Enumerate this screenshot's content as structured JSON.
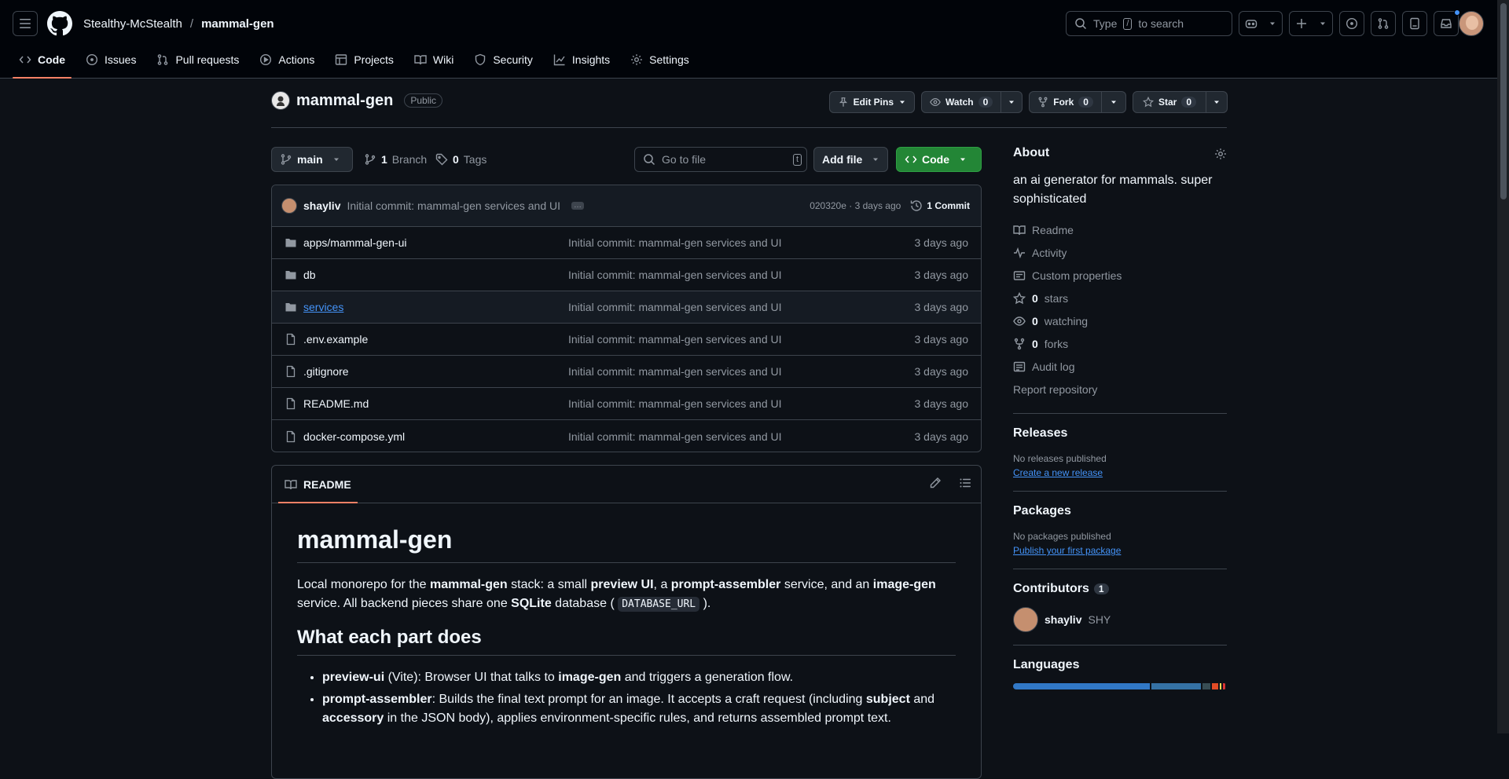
{
  "header": {
    "owner": "Stealthy-McStealth",
    "separator": "/",
    "repo": "mammal-gen",
    "search_prefix": "Type",
    "search_key": "/",
    "search_suffix": "to search"
  },
  "tabs": [
    {
      "label": "Code",
      "icon": "code-icon"
    },
    {
      "label": "Issues",
      "icon": "issue-icon"
    },
    {
      "label": "Pull requests",
      "icon": "pull-request-icon"
    },
    {
      "label": "Actions",
      "icon": "play-icon"
    },
    {
      "label": "Projects",
      "icon": "table-icon"
    },
    {
      "label": "Wiki",
      "icon": "book-icon"
    },
    {
      "label": "Security",
      "icon": "shield-icon"
    },
    {
      "label": "Insights",
      "icon": "graph-icon"
    },
    {
      "label": "Settings",
      "icon": "gear-icon"
    }
  ],
  "repo": {
    "name": "mammal-gen",
    "visibility": "Public",
    "edit_pins": "Edit Pins",
    "watch": "Watch",
    "watch_count": "0",
    "fork": "Fork",
    "fork_count": "0",
    "star": "Star",
    "star_count": "0"
  },
  "toolbar": {
    "branch": "main",
    "branches_count": "1",
    "branches_label": "Branch",
    "tags_count": "0",
    "tags_label": "Tags",
    "go_to_file": "Go to file",
    "go_to_file_key": "t",
    "add_file": "Add file",
    "code": "Code"
  },
  "commit": {
    "author": "shayliv",
    "message": "Initial commit: mammal-gen services and UI",
    "sha": "020320e",
    "dot": "·",
    "age": "3 days ago",
    "count": "1 Commit"
  },
  "files": [
    {
      "name": "apps/mammal-gen-ui",
      "type": "dir",
      "message": "Initial commit: mammal-gen services and UI",
      "age": "3 days ago"
    },
    {
      "name": "db",
      "type": "dir",
      "message": "Initial commit: mammal-gen services and UI",
      "age": "3 days ago"
    },
    {
      "name": "services",
      "type": "dir",
      "message": "Initial commit: mammal-gen services and UI",
      "age": "3 days ago"
    },
    {
      "name": ".env.example",
      "type": "file",
      "message": "Initial commit: mammal-gen services and UI",
      "age": "3 days ago"
    },
    {
      "name": ".gitignore",
      "type": "file",
      "message": "Initial commit: mammal-gen services and UI",
      "age": "3 days ago"
    },
    {
      "name": "README.md",
      "type": "file",
      "message": "Initial commit: mammal-gen services and UI",
      "age": "3 days ago"
    },
    {
      "name": "docker-compose.yml",
      "type": "file",
      "message": "Initial commit: mammal-gen services and UI",
      "age": "3 days ago"
    }
  ],
  "readme": {
    "tab": "README",
    "title": "mammal-gen",
    "intro": {
      "t1": "Local monorepo for the ",
      "b1": "mammal-gen",
      "t2": " stack: a small ",
      "b2": "preview UI",
      "t3": ", a ",
      "b3": "prompt-assembler",
      "t4": " service, and an ",
      "b4": "image-gen",
      "t5": " service. All backend pieces share one ",
      "b5": "SQLite",
      "t6": " database ( ",
      "code": "DATABASE_URL",
      "t7": " )."
    },
    "h2": "What each part does",
    "items": [
      {
        "b1": "preview-ui",
        "t1": " (Vite): Browser UI that talks to ",
        "b2": "image-gen",
        "t2": " and triggers a generation flow.",
        "b3": "",
        "t3": ""
      },
      {
        "b1": "prompt-assembler",
        "t1": ": Builds the final text prompt for an image. It accepts a craft request (including ",
        "b2": "subject",
        "t2": " and ",
        "b3": "accessory",
        "t3": " in the JSON body), applies environment-specific rules, and returns assembled prompt text."
      }
    ]
  },
  "sidebar": {
    "about": "About",
    "description": "an ai generator for mammals. super sophisticated",
    "links": [
      {
        "icon": "book-icon",
        "count": "",
        "label": "Readme"
      },
      {
        "icon": "pulse-icon",
        "count": "",
        "label": "Activity"
      },
      {
        "icon": "note-icon",
        "count": "",
        "label": "Custom properties"
      },
      {
        "icon": "star-icon",
        "count": "0",
        "label": "stars"
      },
      {
        "icon": "eye-icon",
        "count": "0",
        "label": "watching"
      },
      {
        "icon": "fork-icon",
        "count": "0",
        "label": "forks"
      },
      {
        "icon": "log-icon",
        "count": "",
        "label": "Audit log"
      }
    ],
    "report": "Report repository",
    "releases": "Releases",
    "no_releases": "No releases published",
    "create_release": "Create a new release",
    "packages": "Packages",
    "no_packages": "No packages published",
    "publish_package": "Publish your first package",
    "contributors": "Contributors",
    "contributors_count": "1",
    "contributor_name": "shayliv",
    "contributor_handle": "SHY",
    "languages": "Languages",
    "language_bar": [
      {
        "color": "#3178c6",
        "fraction": 0.67
      },
      {
        "color": "#3572a5",
        "fraction": 0.24
      },
      {
        "color": "#384d54",
        "fraction": 0.04
      },
      {
        "color": "#e34c26",
        "fraction": 0.03
      },
      {
        "color": "#f1e05a",
        "fraction": 0.01
      },
      {
        "color": "#da3434",
        "fraction": 0.01
      }
    ]
  },
  "colors": {
    "accent": "#f78166",
    "link": "#4493f8",
    "primary_button": "#238636"
  }
}
